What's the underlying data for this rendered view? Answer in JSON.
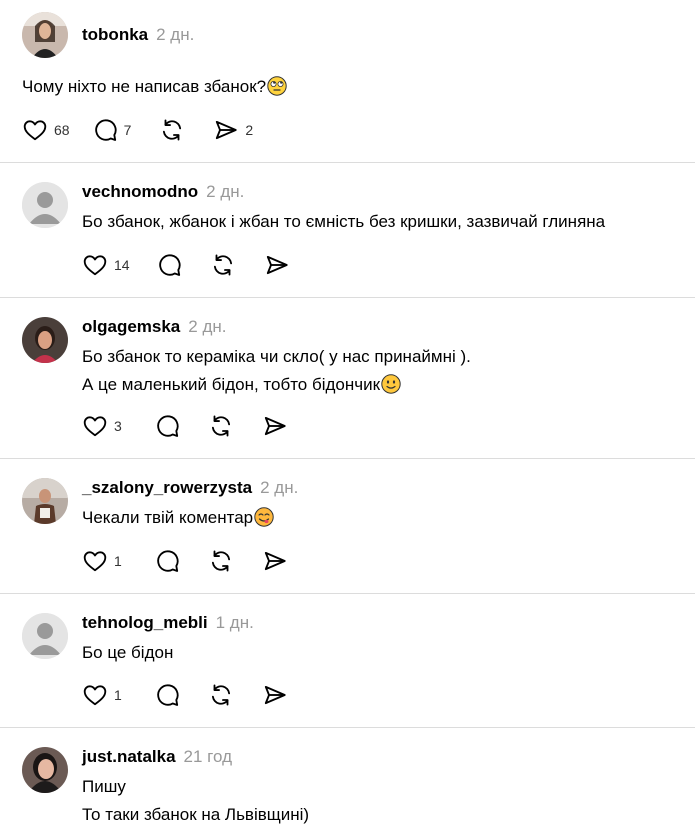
{
  "post": {
    "username": "tobonka",
    "time": "2 дн.",
    "text": "Чому ніхто не написав збанок?",
    "emoji": "rolling-eyes",
    "likes": "68",
    "replies": "7",
    "shares": "2"
  },
  "replies": [
    {
      "username": "vechnomodno",
      "time": "2 дн.",
      "lines": [
        "Бо збанок, жбанок і жбан то ємність без кришки, зазвичай глиняна"
      ],
      "likes": "14",
      "avatar": "default"
    },
    {
      "username": "olgagemska",
      "time": "2 дн.",
      "lines": [
        "Бо збанок то кераміка чи скло( у нас принаймні ).",
        "А це маленький бідон, тобто бідончик"
      ],
      "emoji": "slight-smile",
      "likes": "3",
      "avatar": "photo"
    },
    {
      "username": "_szalony_rowerzysta",
      "time": "2 дн.",
      "lines": [
        "Чекали твій коментар"
      ],
      "emoji": "yum",
      "likes": "1",
      "avatar": "photo"
    },
    {
      "username": "tehnolog_mebli",
      "time": "1 дн.",
      "lines": [
        "Бо це бідон"
      ],
      "likes": "1",
      "avatar": "default"
    },
    {
      "username": "just.natalka",
      "time": "21 год",
      "lines": [
        "Пишу",
        "То таки збанок на Львівщині)"
      ],
      "avatar": "photo"
    }
  ],
  "colors": {
    "divider": "#dcdcdc",
    "timestamp": "#999999",
    "icon": "#000000"
  }
}
